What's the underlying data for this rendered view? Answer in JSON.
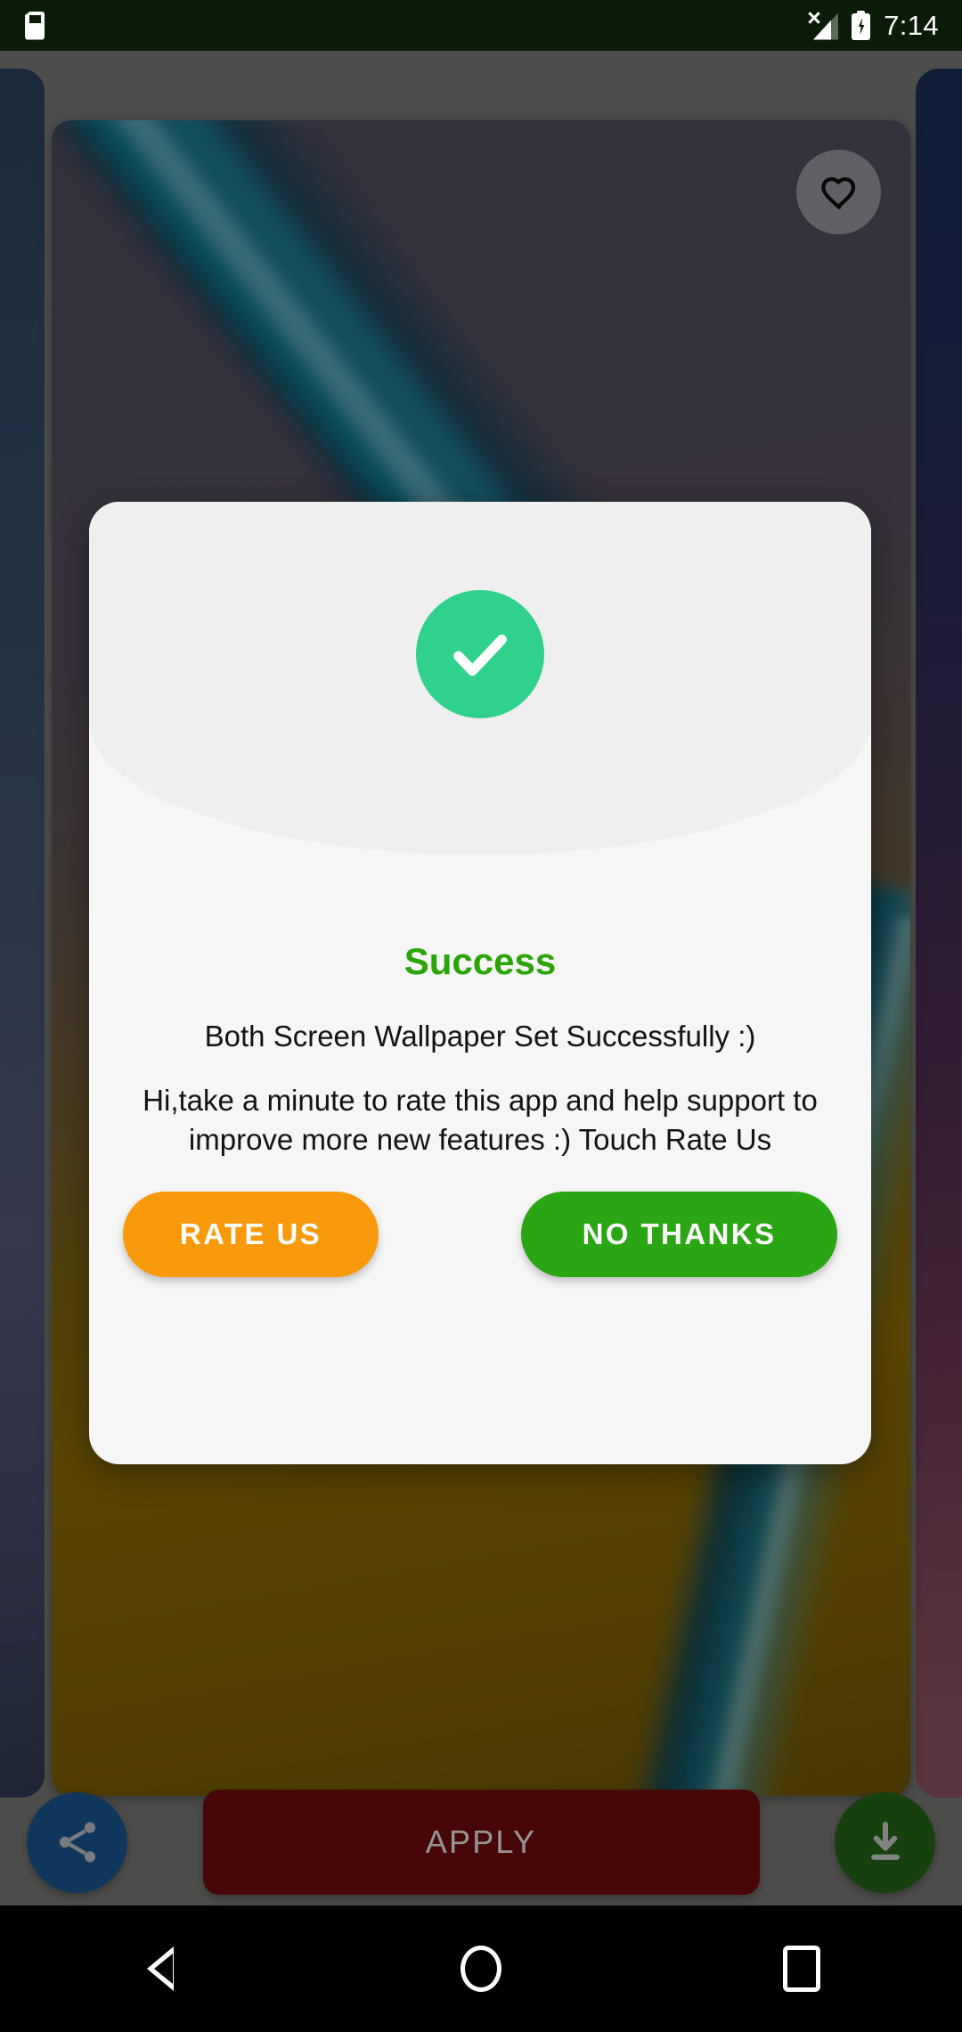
{
  "status_bar": {
    "time": "7:14",
    "icons": {
      "sd_card": "sd-card-icon",
      "signal": "signal-no-service-icon",
      "battery": "battery-charging-icon"
    },
    "background_color": "#0a1c07"
  },
  "wallpaper_screen": {
    "favorite_icon": "heart-outline-icon",
    "cards": {
      "left_peek": "wallpaper-thumbnail-previous",
      "main": "wallpaper-preview-current",
      "right_peek": "wallpaper-thumbnail-next"
    },
    "action_bar": {
      "share_icon": "share-icon",
      "apply_label": "APPLY",
      "download_icon": "download-icon",
      "share_color": "#1a5f9e",
      "apply_color": "#7c0d0d",
      "download_color": "#27701a"
    }
  },
  "dialog": {
    "status_icon": "check-circle-icon",
    "title": "Success",
    "title_color": "#2ba406",
    "message": "Both Screen Wallpaper Set Successfully :)",
    "sub_message": "Hi,take a minute to rate this app and help support to improve more new features :) Touch Rate Us",
    "buttons": {
      "rate_label": "RATE US",
      "rate_color": "#f99a0d",
      "no_thanks_label": "NO THANKS",
      "no_thanks_color": "#2aa514"
    },
    "accent_color": "#30d18d"
  },
  "nav_bar": {
    "back_icon": "back-triangle-icon",
    "home_icon": "home-circle-icon",
    "recents_icon": "recents-square-icon"
  }
}
